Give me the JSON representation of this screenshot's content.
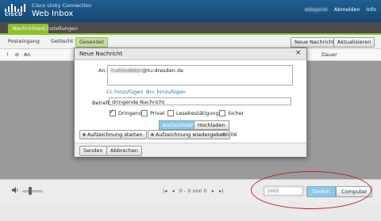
{
  "header": {
    "logo_text": "CISCO",
    "product": "Cisco Unity Connection",
    "app": "Web Inbox",
    "username": "wdaysrie",
    "logout": "Abmelden",
    "info": "Info"
  },
  "tabs": [
    {
      "label": "Nachrichten",
      "active": true
    },
    {
      "label": "Einstellungen",
      "active": false
    }
  ],
  "folders": {
    "inbox": "Posteingang",
    "deleted": "Gelöscht",
    "sent": "Gesendet"
  },
  "toolbar": {
    "new_message": "Neue Nachricht",
    "refresh": "Aktualisieren"
  },
  "list_header": {
    "icons": "! ⊘",
    "to": "An",
    "duration": "Dauer"
  },
  "pager": {
    "text": "0 - 0 von 0",
    "first": "|◂",
    "prev": "◂",
    "next": "▸",
    "last": "▸|"
  },
  "playback": {
    "phone_number": "3469",
    "phone_label": "Telefon",
    "computer_label": "Computer",
    "active": "Telefon"
  },
  "dialog": {
    "title": "Neue Nachricht",
    "close": "×",
    "to_label": "An:",
    "to_value_hidden": "mafalsdebst",
    "to_value_domain": "@tu-dresden.de",
    "cc_link": "Cc hinzufügen",
    "bcc_link": "Bcc hinzufügen",
    "subject_label": "Betreff:",
    "subject_value": "dringende Nachricht",
    "options": [
      {
        "label": "Dringend",
        "checked": true
      },
      {
        "label": "Privat",
        "checked": false
      },
      {
        "label": "Lesebestätigung",
        "checked": false
      },
      {
        "label": "Sicher",
        "checked": false
      }
    ],
    "record_tab": "Aufzeichnen",
    "upload_tab": "Hochladen",
    "start_record": "Aufzeichnung starten",
    "play_record": "Aufzeichnung wiedergeben",
    "record_time": "00:06",
    "send": "Senden",
    "cancel": "Abbrechen"
  },
  "colors": {
    "header": "#1a5383",
    "accent_green": "#8fbf2f",
    "active_blue": "#8ec7ea",
    "annotation_red": "#c0232b"
  }
}
